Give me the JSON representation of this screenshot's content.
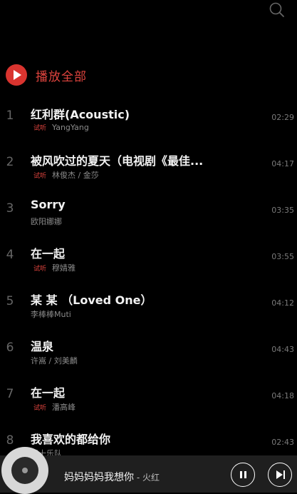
{
  "header": {
    "search_icon": "search-icon"
  },
  "play_all": {
    "label": "播放全部",
    "icon": "play-circle-icon"
  },
  "songs": [
    {
      "index": "1",
      "title": "红利群(Acoustic)",
      "tag": "试听",
      "artist": "YangYang",
      "duration": "02:29"
    },
    {
      "index": "2",
      "title": "被风吹过的夏天（电视剧《最佳...",
      "tag": "试听",
      "artist": "林俊杰 / 金莎",
      "duration": "04:17"
    },
    {
      "index": "3",
      "title": "Sorry",
      "tag": "",
      "artist": "欧阳娜娜",
      "duration": "03:35"
    },
    {
      "index": "4",
      "title": "在一起",
      "tag": "试听",
      "artist": "穆婧雅",
      "duration": "03:55"
    },
    {
      "index": "5",
      "title": "某 某 （Loved One）",
      "tag": "",
      "artist": "李棒棒Muti",
      "duration": "04:12"
    },
    {
      "index": "6",
      "title": "温泉",
      "tag": "",
      "artist": "许嵩 / 刘美麟",
      "duration": "04:43"
    },
    {
      "index": "7",
      "title": "在一起",
      "tag": "试听",
      "artist": "潘高峰",
      "duration": "04:18"
    },
    {
      "index": "8",
      "title": "我喜欢的都给你",
      "tag": "",
      "artist": "罗十乐队",
      "duration": "02:43"
    }
  ],
  "player": {
    "title": "妈妈妈妈我想你",
    "separator": " - ",
    "artist": "火红",
    "pause_icon": "pause-icon",
    "playlist_icon": "playlist-icon"
  }
}
